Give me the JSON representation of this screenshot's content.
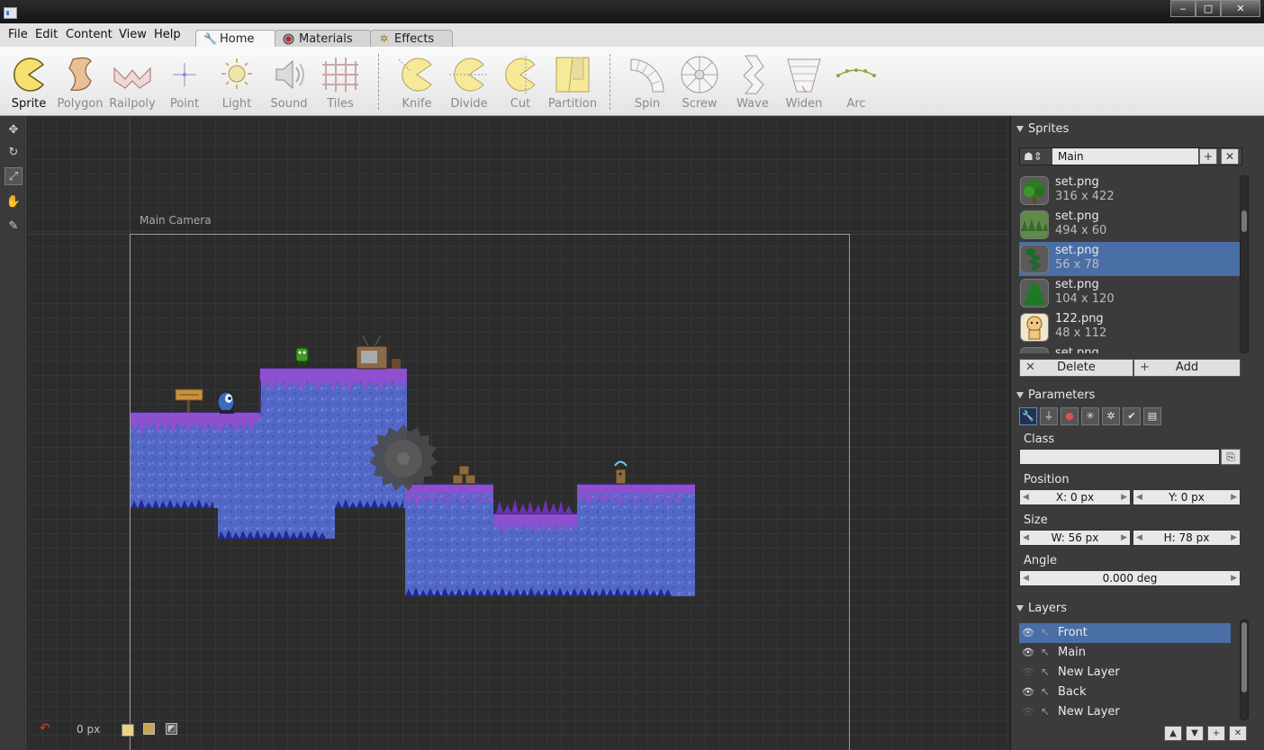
{
  "window": {
    "minimize": "‒",
    "maximize": "□",
    "close": "✕"
  },
  "menu": [
    "File",
    "Edit",
    "Content",
    "View",
    "Help"
  ],
  "tabs": [
    {
      "label": "Home",
      "icon": "wrench-icon",
      "active": true
    },
    {
      "label": "Materials",
      "icon": "material-sphere-icon",
      "active": false
    },
    {
      "label": "Effects",
      "icon": "sparkle-icon",
      "active": false
    }
  ],
  "toolbar": {
    "tools": [
      "Sprite",
      "Polygon",
      "Railpoly",
      "Point",
      "Light",
      "Sound",
      "Tiles"
    ],
    "ops": [
      "Knife",
      "Divide",
      "Cut",
      "Partition"
    ],
    "shapes": [
      "Spin",
      "Screw",
      "Wave",
      "Widen",
      "Arc"
    ]
  },
  "canvas": {
    "camera_label": "Main Camera",
    "zoom": "0 px"
  },
  "sprites_panel": {
    "title": "Sprites",
    "group": "Main",
    "items": [
      {
        "name": "set.png",
        "size": "316 x 422",
        "selected": false
      },
      {
        "name": "set.png",
        "size": "494 x 60",
        "selected": false
      },
      {
        "name": "set.png",
        "size": "56 x 78",
        "selected": true
      },
      {
        "name": "set.png",
        "size": "104 x 120",
        "selected": false
      },
      {
        "name": "122.png",
        "size": "48 x 112",
        "selected": false
      },
      {
        "name": "set.png",
        "size": "",
        "selected": false
      }
    ],
    "delete_label": "Delete",
    "add_label": "Add"
  },
  "parameters_panel": {
    "title": "Parameters",
    "class_label": "Class",
    "class_value": "",
    "position_label": "Position",
    "x": "X: 0 px",
    "y": "Y: 0 px",
    "size_label": "Size",
    "w": "W: 56 px",
    "h": "H: 78 px",
    "angle_label": "Angle",
    "angle": "0.000 deg"
  },
  "layers_panel": {
    "title": "Layers",
    "items": [
      {
        "name": "Front",
        "visible": true,
        "selected": true
      },
      {
        "name": "Main",
        "visible": true,
        "selected": false
      },
      {
        "name": "New Layer",
        "visible": false,
        "selected": false
      },
      {
        "name": "Back",
        "visible": true,
        "selected": false
      },
      {
        "name": "New Layer",
        "visible": false,
        "selected": false
      }
    ]
  },
  "colors": {
    "accent": "#4a6ea6",
    "panel": "#3b3b3b",
    "canvas": "#2c2c2c",
    "ground": "#5066c8",
    "grass": "#8e4fd0"
  }
}
